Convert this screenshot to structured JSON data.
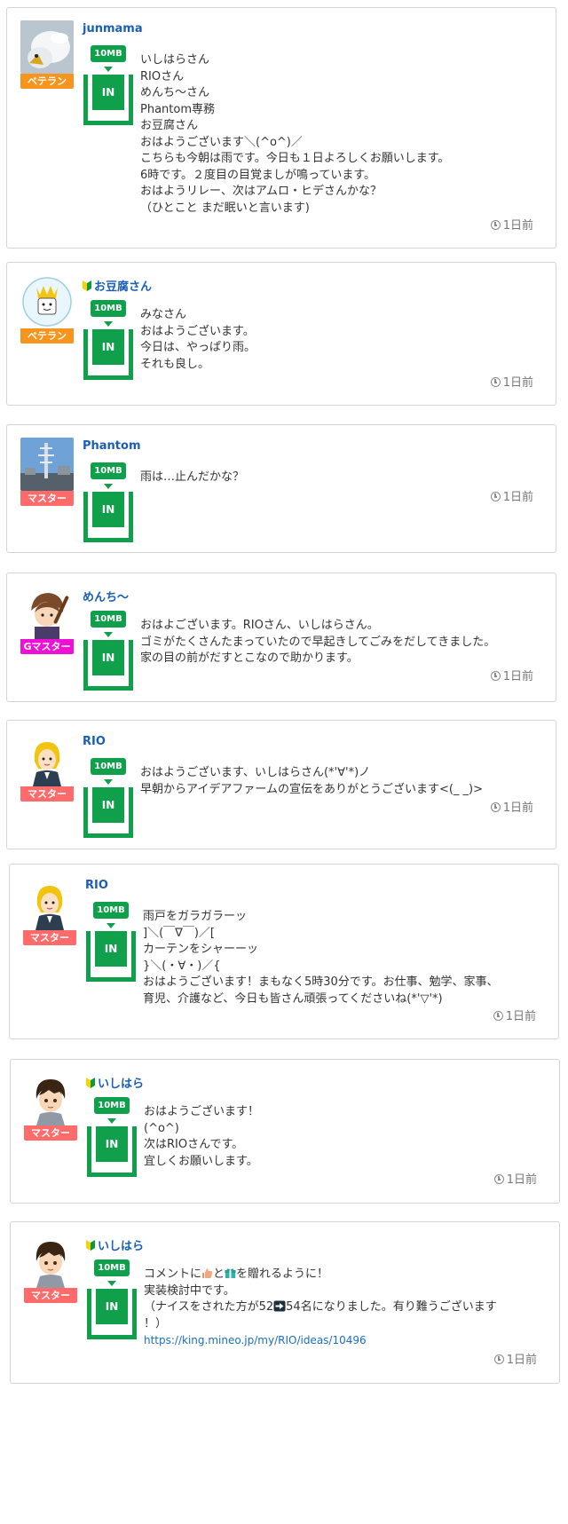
{
  "posts": [
    {
      "username": "junmama",
      "rank": "ベテラン",
      "gauge_label": "10MB",
      "in_label": "IN",
      "time": "1日前",
      "lines": [
        "いしはらさん",
        "RIOさん",
        "めんち～さん",
        "Phantom専務",
        "お豆腐さん",
        "おはようございます＼(^o^)／",
        "こちらも今朝は雨です。今日も１日よろしくお願いします。",
        "6時です。２度目の目覚ましが鳴っています。",
        "おはようリレー、次はアムロ・ヒデさんかな？",
        "（ひとこと まだ眠いと言います)"
      ]
    },
    {
      "username": "お豆腐さん",
      "rank": "ベテラン",
      "gauge_label": "10MB",
      "in_label": "IN",
      "time": "1日前",
      "lines": [
        "みなさん",
        "おはようございます。",
        "今日は、やっぱり雨。",
        "それも良し。"
      ]
    },
    {
      "username": "Phantom",
      "rank": "マスター",
      "gauge_label": "10MB",
      "in_label": "IN",
      "time": "1日前",
      "lines": [
        "雨は…止んだかな？"
      ]
    },
    {
      "username": "めんち～",
      "rank": "Gマスター",
      "gauge_label": "10MB",
      "in_label": "IN",
      "time": "1日前",
      "lines": [
        "おはよございます。RIOさん、いしはらさん。",
        "ゴミがたくさんたまっていたので早起きしてごみをだしてきました。",
        "家の目の前がだすとこなので助かります。"
      ]
    },
    {
      "username": "RIO",
      "rank": "マスター",
      "gauge_label": "10MB",
      "in_label": "IN",
      "time": "1日前",
      "lines": [
        "おはようございます、いしはらさん(*'∀'*)ノ",
        "早朝からアイデアファームの宣伝をありがとうございます<(_ _)>"
      ]
    },
    {
      "username": "RIO",
      "rank": "マスター",
      "gauge_label": "10MB",
      "in_label": "IN",
      "time": "1日前",
      "lines": [
        "雨戸をガラガラーッ",
        "]＼(￣∇￣)／[",
        "カーテンをシャーーッ",
        "}＼(・∀・)／{",
        "おはようございます！まもなく5時30分です。お仕事、勉学、家事、",
        "育児、介護など、今日も皆さん頑張ってくださいね(*'▽'*)"
      ]
    },
    {
      "username": "いしはら",
      "rank": "マスター",
      "gauge_label": "10MB",
      "in_label": "IN",
      "time": "1日前",
      "lines": [
        "おはようございます！",
        "(^o^)",
        "次はRIOさんです。",
        "宜しくお願いします。"
      ]
    },
    {
      "username": "いしはら",
      "rank": "マスター",
      "gauge_label": "10MB",
      "in_label": "IN",
      "time": "1日前",
      "line_parts": [
        "コメントに",
        "と",
        "を贈れるように！"
      ],
      "lines": [
        "実装検討中です。",
        "（ナイスをされた方が52",
        "54名になりました。有り難うございます",
        "！）"
      ],
      "link": "https://king.mineo.jp/my/RIO/ideas/10496"
    }
  ],
  "colors": {
    "gauge_green": "#10a04b",
    "username_blue": "#1a5fb4",
    "veteran": "#f7941d",
    "master": "#ff6b6b",
    "gmaster": "#ee10d6"
  },
  "icons": [
    "beginner-mark-icon",
    "clock-icon",
    "thumbs-up-icon",
    "gift-icon",
    "arrow-right-icon"
  ]
}
